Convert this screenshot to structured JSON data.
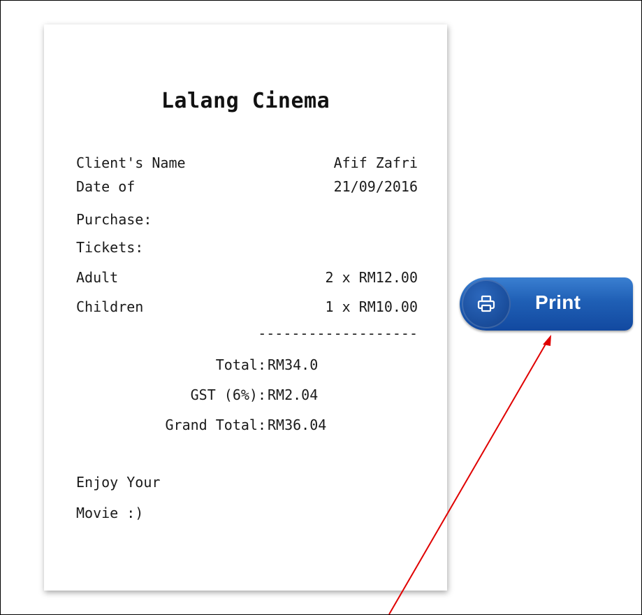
{
  "receipt": {
    "title": "Lalang Cinema",
    "client_label": "Client's Name",
    "client_value": "Afif Zafri",
    "date_label_line1": "Date of",
    "date_label_line2": "Purchase:",
    "date_value": "21/09/2016",
    "tickets_label": "Tickets:",
    "adult_label": "Adult",
    "adult_value": "2 x RM12.00",
    "children_label": "Children",
    "children_value": "1 x RM10.00",
    "divider": "-------------------",
    "total_label": "Total:",
    "total_value": "RM34.0",
    "gst_label": "GST (6%):",
    "gst_value": "RM2.04",
    "grand_total_label": "Grand Total:",
    "grand_total_value": "RM36.04",
    "footer_line1": "Enjoy Your",
    "footer_line2": "Movie :)"
  },
  "print_button": {
    "label": "Print",
    "icon": "printer-icon"
  },
  "colors": {
    "button_blue": "#1f5fb5",
    "arrow": "#e00000"
  }
}
